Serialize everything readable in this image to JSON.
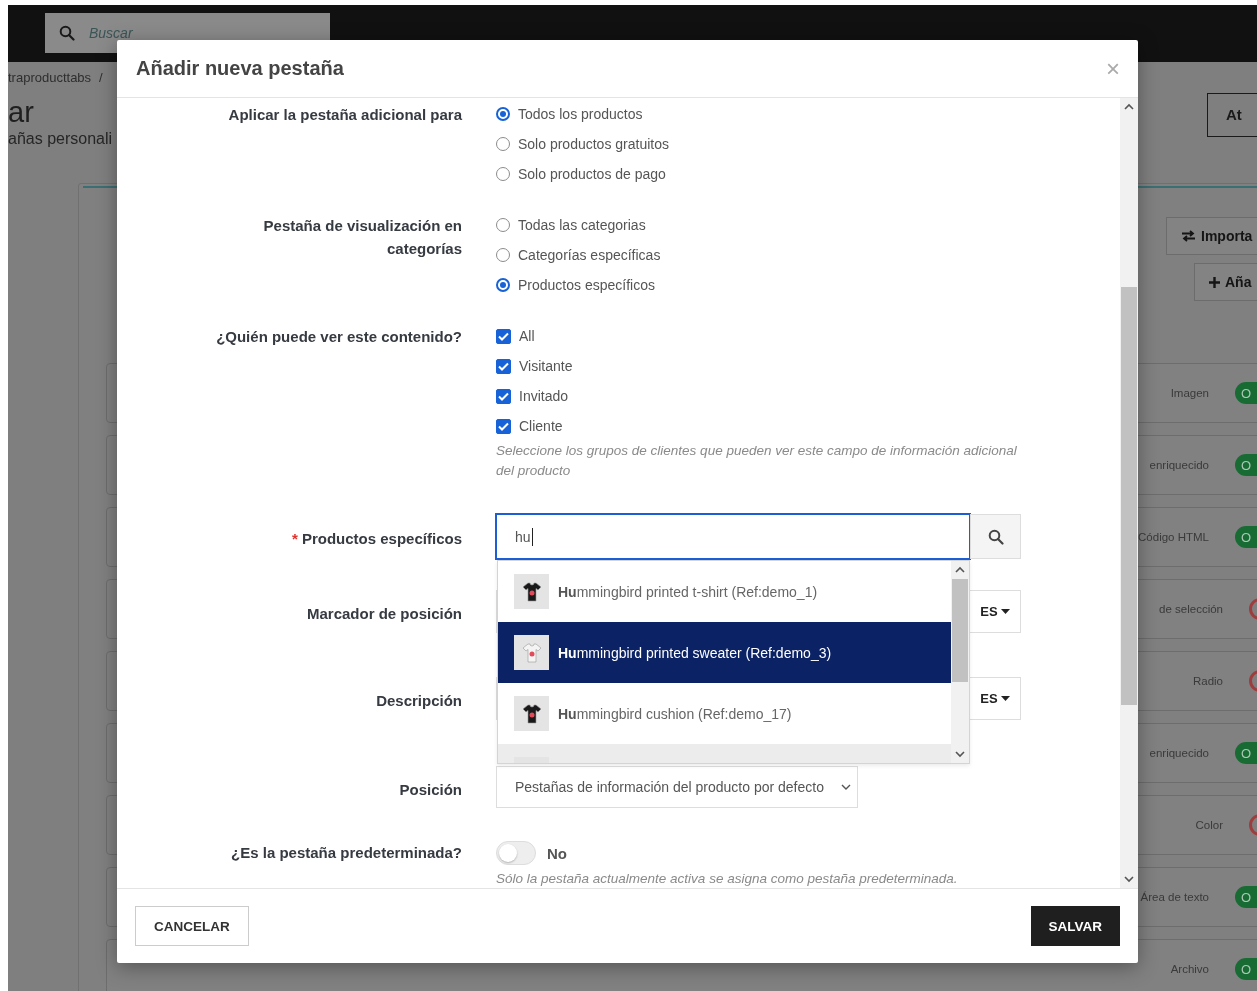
{
  "background": {
    "search": {
      "placeholder": "Buscar"
    },
    "breadcrumb": "traproducttabs",
    "breadcrumb_separator": "/",
    "title": "ar",
    "subtitle": "añas personali",
    "header_button": "At",
    "card": {
      "buttons": [
        {
          "kind": "import",
          "label": "Importa"
        },
        {
          "kind": "add",
          "label": "Aña"
        }
      ],
      "rows": [
        {
          "type": "Imagen",
          "enabled": true,
          "toggle_text": "O"
        },
        {
          "type": "enriquecido",
          "enabled": true,
          "toggle_text": "O"
        },
        {
          "type": "Código HTML",
          "enabled": true,
          "toggle_text": "O"
        },
        {
          "type": "de selección",
          "enabled": false
        },
        {
          "type": "Radio",
          "enabled": false
        },
        {
          "type": "enriquecido",
          "enabled": true,
          "toggle_text": "O"
        },
        {
          "type": "Color",
          "enabled": false
        },
        {
          "type": "Área de texto",
          "enabled": true,
          "toggle_text": "O"
        },
        {
          "type": "Archivo",
          "enabled": true,
          "toggle_text": "O"
        }
      ]
    }
  },
  "modal": {
    "title": "Añadir nueva pestaña",
    "close": "×",
    "fields": [
      {
        "kind": "radio",
        "label": "Aplicar la pestaña adicional para",
        "options": [
          {
            "label": "Todos los productos",
            "selected": true
          },
          {
            "label": "Solo productos gratuitos",
            "selected": false
          },
          {
            "label": "Solo productos de pago",
            "selected": false
          }
        ]
      },
      {
        "kind": "radio",
        "label": "Pestaña de visualización en categorías",
        "options": [
          {
            "label": "Todas las categorias",
            "selected": false
          },
          {
            "label": "Categorías específicas",
            "selected": false
          },
          {
            "label": "Productos específicos",
            "selected": true
          }
        ]
      },
      {
        "kind": "checkbox",
        "label": "¿Quién puede ver este contenido?",
        "options": [
          {
            "label": "All",
            "checked": true
          },
          {
            "label": "Visitante",
            "checked": true
          },
          {
            "label": "Invitado",
            "checked": true
          },
          {
            "label": "Cliente",
            "checked": true
          }
        ],
        "help": "Seleccione los grupos de clientes que pueden ver este campo de información adicional del producto"
      },
      {
        "kind": "search",
        "label": "Productos específicos",
        "required_mark": "*",
        "value": "hu",
        "suggestions": [
          {
            "label": "**Hu**mmingbird printed t-shirt (Ref:demo_1)",
            "selected": false,
            "hovered": false
          },
          {
            "label": "**Hu**mmingbird printed sweater (Ref:demo_3)",
            "selected": true,
            "hovered": false
          },
          {
            "label": "**Hu**mmingbird cushion (Ref:demo_17)",
            "selected": false,
            "hovered": false
          },
          {
            "selected": false,
            "hovered": true
          }
        ]
      },
      {
        "kind": "lang",
        "label": "Marcador de posición",
        "lang": "ES"
      },
      {
        "kind": "lang",
        "label": "Descripción",
        "lang": "ES"
      },
      {
        "kind": "select",
        "label": "Posición",
        "value": "Pestañas de información del producto por defecto"
      },
      {
        "kind": "switch",
        "label": "¿Es la pestaña predeterminada?",
        "on": false,
        "state_text": "No",
        "help": "Sólo la pestaña actualmente activa se asigna como pestaña predeterminada."
      }
    ],
    "footer": {
      "cancel": "CANCELAR",
      "save": "SALVAR"
    }
  }
}
